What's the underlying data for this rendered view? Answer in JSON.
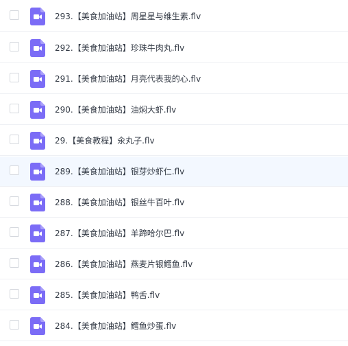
{
  "colors": {
    "icon_bg": "#7b6cf6",
    "icon_fold": "#a99ffa",
    "highlight_row": "#f3f8ff",
    "text": "#333a45"
  },
  "file_icon": "video-file-icon",
  "files": [
    {
      "name": "293.【美食加油站】周星星与维生素.flv"
    },
    {
      "name": "292.【美食加油站】珍珠牛肉丸.flv"
    },
    {
      "name": "291.【美食加油站】月亮代表我的心.flv"
    },
    {
      "name": "290.【美食加油站】油焖大虾.flv"
    },
    {
      "name": "29.【美食教程】氽丸子.flv"
    },
    {
      "name": "289.【美食加油站】银芽炒虾仁.flv",
      "highlighted": true
    },
    {
      "name": "288.【美食加油站】银丝牛百叶.flv"
    },
    {
      "name": "287.【美食加油站】羊蹄哈尔巴.flv"
    },
    {
      "name": "286.【美食加油站】燕麦片银鳕鱼.flv"
    },
    {
      "name": "285.【美食加油站】鸭舌.flv"
    },
    {
      "name": "284.【美食加油站】鳕鱼炒蛋.flv"
    }
  ]
}
